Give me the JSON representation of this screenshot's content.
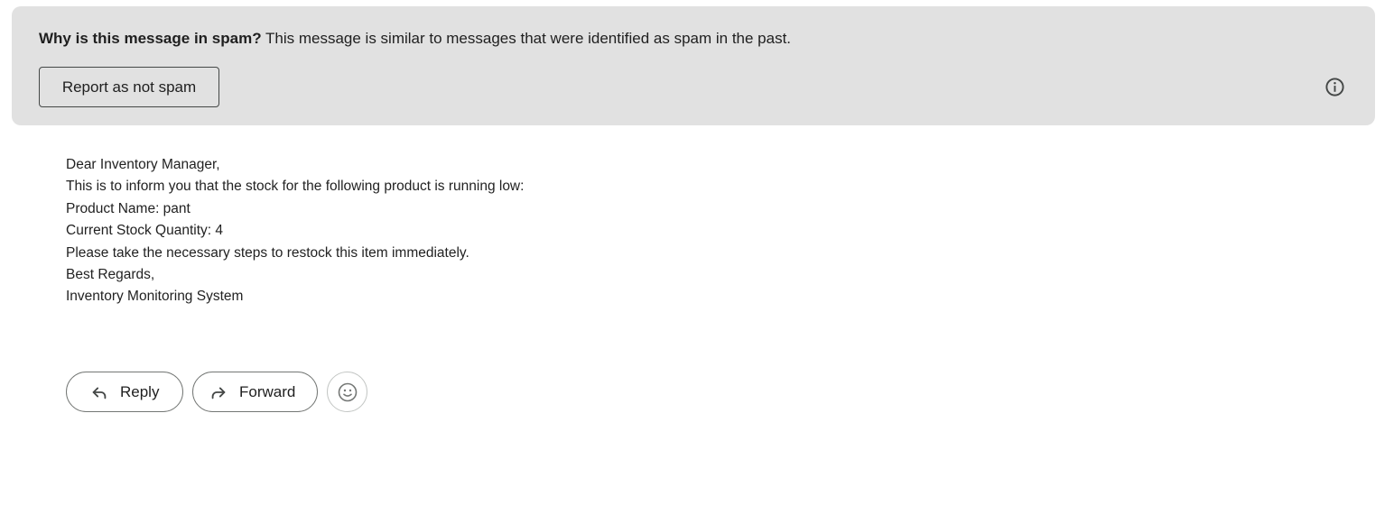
{
  "spam_banner": {
    "question": "Why is this message in spam?",
    "explanation": "This message is similar to messages that were identified as spam in the past.",
    "report_button_label": "Report as not spam",
    "info_icon": "info-icon"
  },
  "message": {
    "lines": [
      "Dear Inventory Manager,",
      "This is to inform you that the stock for the following product is running low:",
      "Product Name: pant",
      "Current Stock Quantity: 4",
      "Please take the necessary steps to restock this item immediately.",
      "Best Regards,",
      "Inventory Monitoring System"
    ]
  },
  "actions": {
    "reply_label": "Reply",
    "reply_icon": "reply-icon",
    "forward_label": "Forward",
    "forward_icon": "forward-icon",
    "emoji_icon": "emoji-icon"
  }
}
